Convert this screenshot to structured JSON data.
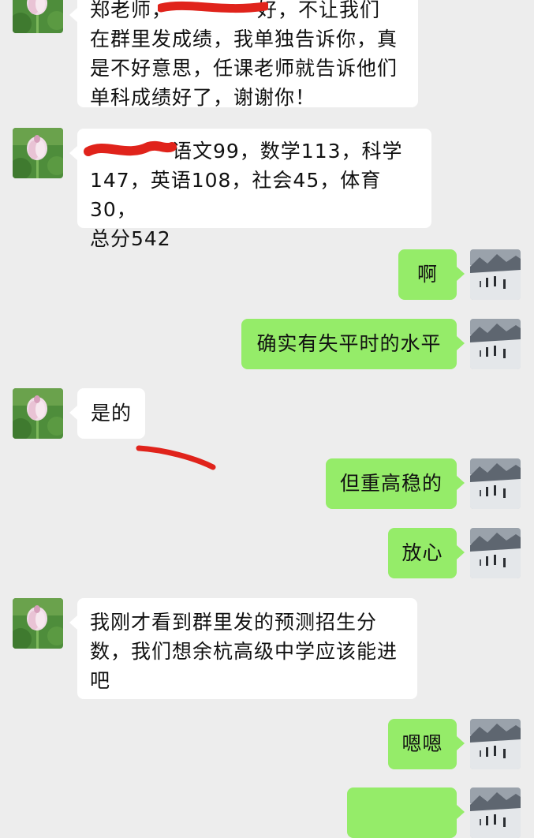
{
  "messages": [
    {
      "sender": "teacher",
      "text": "郑老师，████████好，不让我们在群里发成绩，我单独告诉你，真是不好意思，任课老师就告诉他们单科成绩好了，谢谢你！"
    },
    {
      "sender": "teacher",
      "text": "████：语文99，数学113，科学147，英语108，社会45，体育30，总分542"
    },
    {
      "sender": "parent",
      "text": "啊"
    },
    {
      "sender": "parent",
      "text": "确实有失平时的水平"
    },
    {
      "sender": "teacher",
      "text": "是的"
    },
    {
      "sender": "parent",
      "text": "但重高稳的"
    },
    {
      "sender": "parent",
      "text": "放心"
    },
    {
      "sender": "teacher",
      "text": "我刚才看到群里发的预测招生分数，我们想余杭高级中学应该能进吧"
    },
    {
      "sender": "parent",
      "text": "嗯嗯"
    }
  ],
  "lines": {
    "m1": [
      "郑老师，",
      "好，不让我们",
      "在群里发成绩，我单独告诉你，真",
      "是不好意思，任课老师就告诉他们",
      "单科成绩好了，谢谢你！"
    ],
    "m2": [
      "语文99，数学113，科学",
      "147，英语108，社会45，体育30，",
      "总分542"
    ],
    "m3": "啊",
    "m4": "确实有失平时的水平",
    "m5": "是的",
    "m6": "但重高稳的",
    "m7": "放心",
    "m8": [
      "我刚才看到群里发的预测招生分",
      "数，我们想余杭高级中学应该能进",
      "吧"
    ],
    "m9": "嗯嗯"
  },
  "avatars": {
    "teacher": "lotus-flower-avatar",
    "parent": "snowy-mountain-people-avatar"
  },
  "colors": {
    "background": "#ededed",
    "incoming_bubble": "#ffffff",
    "outgoing_bubble": "#95ec69",
    "redaction": "#e0231b"
  }
}
